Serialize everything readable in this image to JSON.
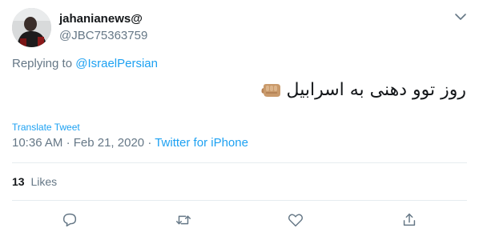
{
  "user": {
    "display_name": "jahanianews@",
    "handle": "@JBC75363759"
  },
  "reply": {
    "prefix": "Replying to",
    "mention": "@IsraelPersian"
  },
  "tweet": {
    "text": "روز توو دهنی به اسرابیل",
    "emoji_icon": "oncoming-fist-icon"
  },
  "translate_label": "Translate Tweet",
  "meta": {
    "time": "10:36 AM",
    "date": "Feb 21, 2020",
    "separator": "·",
    "source": "Twitter for iPhone"
  },
  "stats": {
    "likes_count": "13",
    "likes_label": "Likes"
  },
  "actions": [
    "reply-icon",
    "retweet-icon",
    "like-icon",
    "share-icon"
  ],
  "colors": {
    "accent": "#1da1f2",
    "secondary_text": "#657786",
    "primary_text": "#14171a",
    "divider": "#e6ecf0"
  }
}
